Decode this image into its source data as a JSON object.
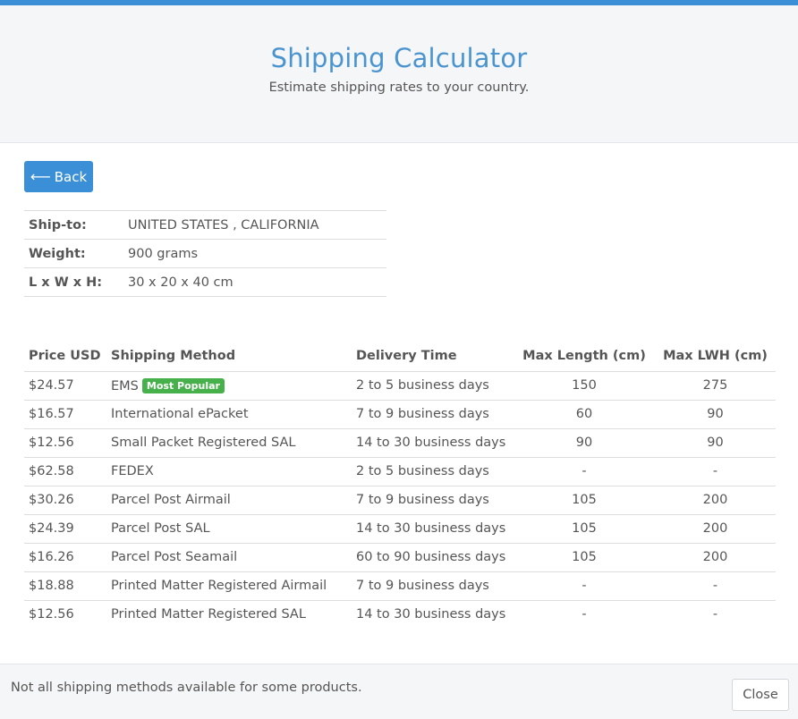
{
  "header": {
    "title": "Shipping Calculator",
    "subtitle": "Estimate shipping rates to your country."
  },
  "back_button": {
    "icon": "arrow-left-icon",
    "label": "Back"
  },
  "shipment": [
    {
      "label": "Ship-to:",
      "value": "UNITED STATES , CALIFORNIA"
    },
    {
      "label": "Weight:",
      "value": "900 grams"
    },
    {
      "label": "L x W x H:",
      "value": "30 x 20 x 40 cm"
    }
  ],
  "rates": {
    "columns": [
      "Price USD",
      "Shipping Method",
      "Delivery Time",
      "Max Length (cm)",
      "Max LWH (cm)"
    ],
    "rows": [
      {
        "price": "$24.57",
        "method": "EMS",
        "badge": "Most Popular",
        "time": "2 to 5 business days",
        "max_length": "150",
        "max_lwh": "275"
      },
      {
        "price": "$16.57",
        "method": "International ePacket",
        "time": "7 to 9 business days",
        "max_length": "60",
        "max_lwh": "90"
      },
      {
        "price": "$12.56",
        "method": "Small Packet Registered SAL",
        "time": "14 to 30 business days",
        "max_length": "90",
        "max_lwh": "90"
      },
      {
        "price": "$62.58",
        "method": "FEDEX",
        "time": "2 to 5 business days",
        "max_length": "-",
        "max_lwh": "-"
      },
      {
        "price": "$30.26",
        "method": "Parcel Post Airmail",
        "time": "7 to 9 business days",
        "max_length": "105",
        "max_lwh": "200"
      },
      {
        "price": "$24.39",
        "method": "Parcel Post SAL",
        "time": "14 to 30 business days",
        "max_length": "105",
        "max_lwh": "200"
      },
      {
        "price": "$16.26",
        "method": "Parcel Post Seamail",
        "time": "60 to 90 business days",
        "max_length": "105",
        "max_lwh": "200"
      },
      {
        "price": "$18.88",
        "method": "Printed Matter Registered Airmail",
        "time": "7 to 9 business days",
        "max_length": "-",
        "max_lwh": "-"
      },
      {
        "price": "$12.56",
        "method": "Printed Matter Registered SAL",
        "time": "14 to 30 business days",
        "max_length": "-",
        "max_lwh": "-"
      }
    ]
  },
  "footer": {
    "note": "Not all shipping methods available for some products.",
    "close_label": "Close"
  },
  "colors": {
    "accent": "#3a8fd6",
    "title": "#4a94d0",
    "badge": "#46b04a"
  }
}
